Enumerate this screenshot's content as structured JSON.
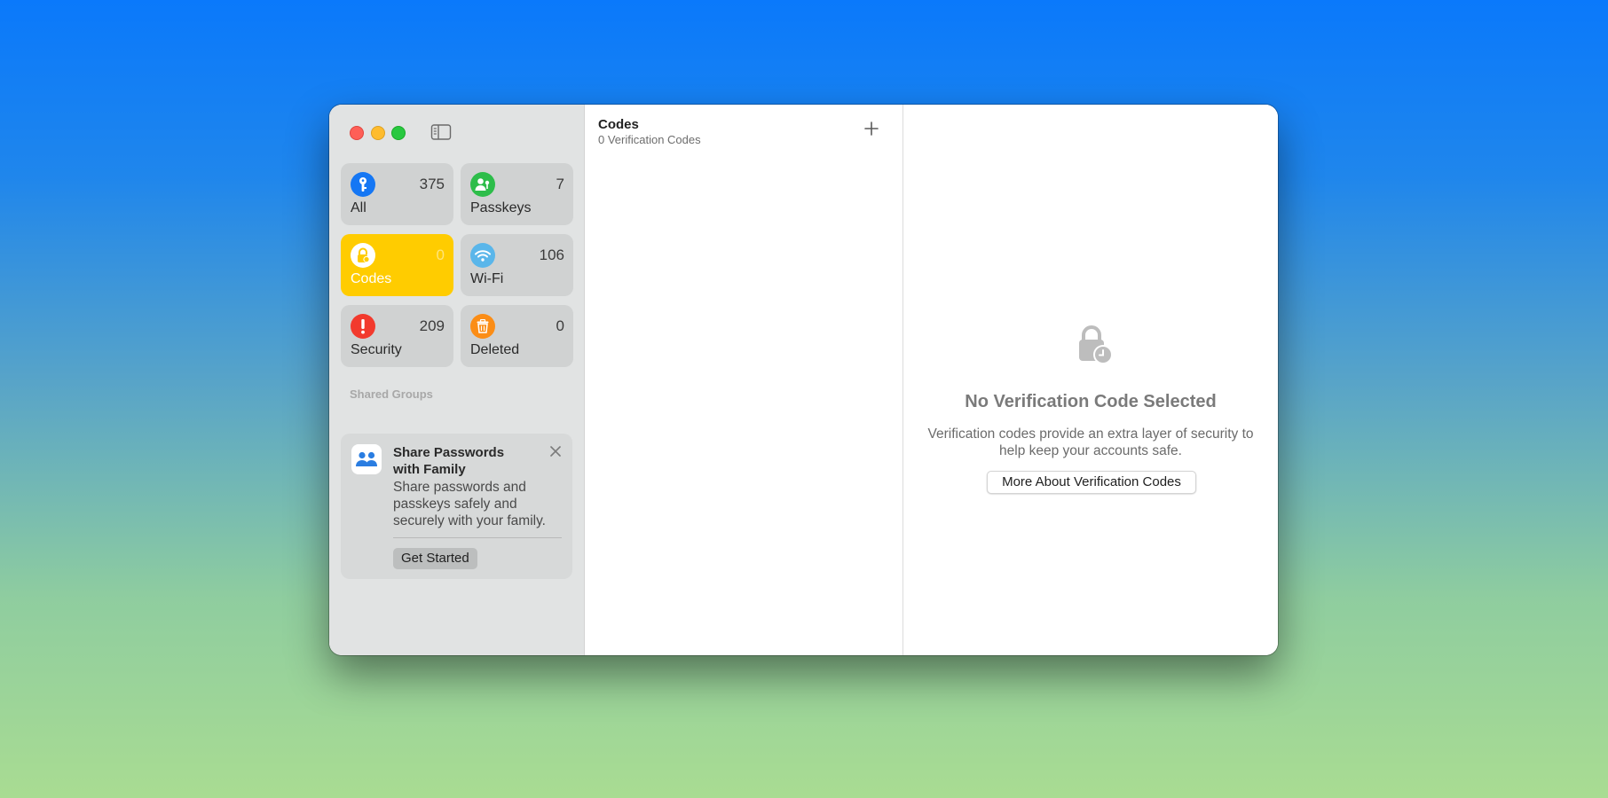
{
  "sidebar": {
    "categories": [
      {
        "label": "All",
        "count": "375",
        "color": "#1577f4",
        "icon": "key-icon"
      },
      {
        "label": "Passkeys",
        "count": "7",
        "color": "#2dbd4a",
        "icon": "person-key-icon"
      },
      {
        "label": "Codes",
        "count": "0",
        "color": "#ffcc00",
        "icon": "lock-clock-icon",
        "selected": true
      },
      {
        "label": "Wi-Fi",
        "count": "106",
        "color": "#5ab6ea",
        "icon": "wifi-icon"
      },
      {
        "label": "Security",
        "count": "209",
        "color": "#f23a2d",
        "icon": "exclamation-icon"
      },
      {
        "label": "Deleted",
        "count": "0",
        "color": "#fb8d16",
        "icon": "trash-icon"
      }
    ],
    "shared_groups_label": "Shared Groups",
    "promo": {
      "title": "Share Passwords with Family",
      "body": "Share passwords and passkeys safely and securely with your family.",
      "button_label": "Get Started",
      "icon": "family-icon"
    }
  },
  "list": {
    "title": "Codes",
    "subtitle": "0 Verification Codes"
  },
  "detail": {
    "title": "No Verification Code Selected",
    "body": "Verification codes provide an extra layer of security to help keep your accounts safe.",
    "button_label": "More About Verification Codes"
  }
}
